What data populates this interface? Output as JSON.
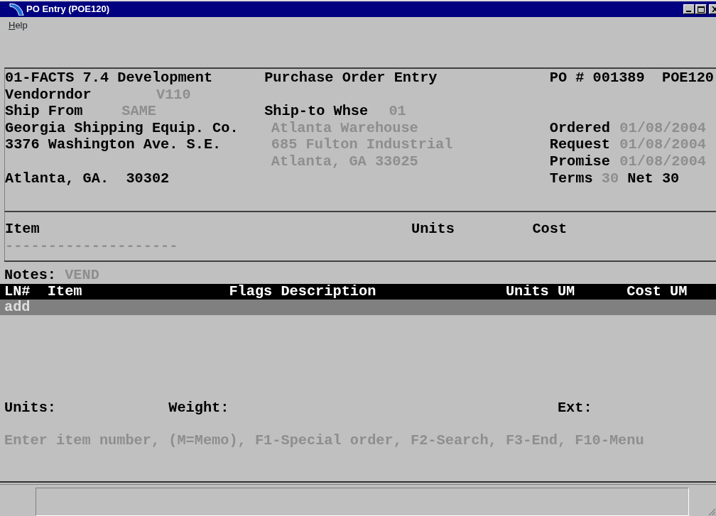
{
  "window": {
    "title": "PO Entry (POE120)"
  },
  "menu": [
    {
      "label": "Help"
    }
  ],
  "header_lines": [
    [
      {
        "text": "01-FACTS 7.4 Development",
        "kind": "label"
      },
      {
        "text": "Purchase Order Entry",
        "kind": "label"
      },
      {
        "text": "PO # 001389",
        "kind": "label"
      },
      {
        "text": "POE120",
        "kind": "label"
      }
    ],
    [
      {
        "text": "Vendorndor",
        "kind": "label"
      },
      {
        "text": "V110",
        "kind": "value"
      }
    ],
    [
      {
        "text": "Ship From",
        "kind": "label"
      },
      {
        "text": "SAME",
        "kind": "value"
      },
      {
        "text": "Ship-to Whse",
        "kind": "label"
      },
      {
        "text": "01",
        "kind": "value"
      }
    ],
    [
      {
        "text": "Georgia Shipping Equip. Co.",
        "kind": "label"
      },
      {
        "text": "Atlanta Warehouse",
        "kind": "value"
      },
      {
        "text": "Ordered",
        "kind": "label"
      },
      {
        "text": "01/08/2004",
        "kind": "value"
      }
    ],
    [
      {
        "text": "3376 Washington Ave. S.E.",
        "kind": "label"
      },
      {
        "text": "685 Fulton Industrial",
        "kind": "value"
      },
      {
        "text": "Request",
        "kind": "label"
      },
      {
        "text": "01/08/2004",
        "kind": "value"
      }
    ],
    [
      {
        "text": "Atlanta, GA 33025",
        "kind": "value"
      },
      {
        "text": "Promise",
        "kind": "label"
      },
      {
        "text": "01/08/2004",
        "kind": "value"
      }
    ],
    [
      {
        "text": "Atlanta, GA.  30302",
        "kind": "label"
      },
      {
        "text": "Terms",
        "kind": "label"
      },
      {
        "text": "30",
        "kind": "value"
      },
      {
        "text": "Net 30",
        "kind": "label"
      }
    ]
  ],
  "entry": {
    "columns": [
      "Item",
      "Units",
      "Cost"
    ],
    "item_value": "--------------------"
  },
  "notes": {
    "label": "Notes:",
    "value": "VEND"
  },
  "lines_table": {
    "columns": [
      "LN#",
      "Item",
      "Flags",
      "Description",
      "Units",
      "UM",
      "Cost",
      "UM"
    ],
    "rows": [
      {
        "text": "add",
        "selected": true
      }
    ]
  },
  "totals": [
    "Units:",
    "Weight:",
    "Ext:"
  ],
  "prompt": "Enter item number, (M=Memo), F1-Special order, F2-Search, F3-End, F10-Menu"
}
